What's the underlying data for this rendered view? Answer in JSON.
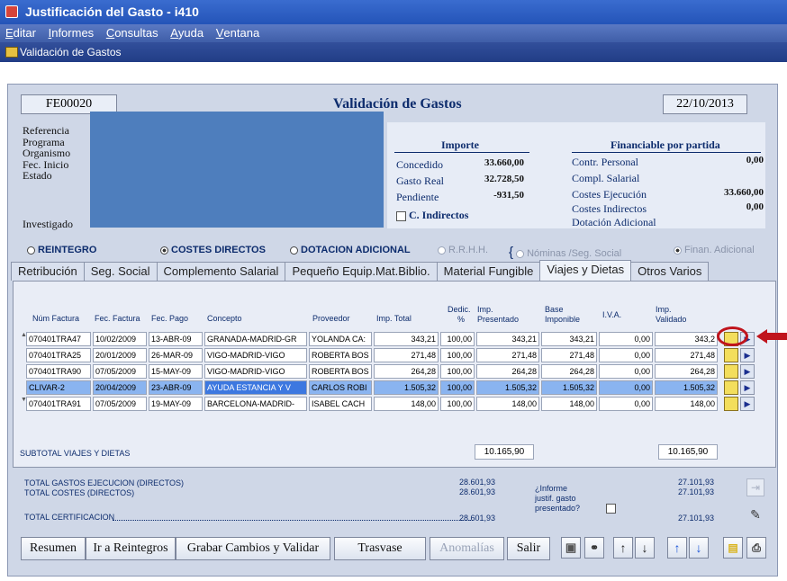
{
  "window": {
    "title": "Justificación del Gasto - i410"
  },
  "menu": [
    {
      "pre": "E",
      "rest": "ditar"
    },
    {
      "pre": "I",
      "rest": "nformes"
    },
    {
      "pre": "C",
      "rest": "onsultas"
    },
    {
      "pre": "A",
      "rest": "yuda"
    },
    {
      "pre": "V",
      "rest": "entana"
    }
  ],
  "subwindow": {
    "title": "Validación de Gastos"
  },
  "header": {
    "doc_number": "FE00020",
    "title": "Validación de Gastos",
    "date": "22/10/2013"
  },
  "info": {
    "labels": [
      "Referencia",
      "Programa",
      "Organismo",
      "Fec. Inicio",
      "Estado"
    ],
    "investigador": "Investigado"
  },
  "importe": {
    "heading": "Importe",
    "rows": [
      {
        "label": "Concedido",
        "value": "33.660,00"
      },
      {
        "label": "Gasto Real",
        "value": "32.728,50"
      },
      {
        "label": "Pendiente",
        "value": "-931,50"
      }
    ],
    "c_indirectos": "C. Indirectos"
  },
  "financiable": {
    "heading": "Financiable por partida",
    "rows": [
      {
        "label": "Contr. Personal",
        "value": "0,00"
      },
      {
        "label": "Compl. Salarial",
        "value": ""
      },
      {
        "label": "Costes Ejecución",
        "value": "33.660,00"
      },
      {
        "label": "Costes Indirectos",
        "value": "0,00"
      },
      {
        "label": "Dotación Adicional",
        "value": ""
      }
    ]
  },
  "options": {
    "reintegro": "REINTEGRO",
    "costes_directos": "COSTES DIRECTOS",
    "dotacion": "DOTACION ADICIONAL",
    "rrhh": "R.R.H.H.",
    "nominas": "Nóminas /Seg. Social",
    "finan": "Finan. Adicional"
  },
  "tabs": [
    "Retribución",
    "Seg. Social",
    "Complemento Salarial",
    "Pequeño Equip.Mat.Biblio.",
    "Material Fungible",
    "Viajes y Dietas",
    "Otros Varios"
  ],
  "active_tab": "Viajes y Dietas",
  "columns": {
    "num_factura": "Núm Factura",
    "fec_factura": "Fec. Factura",
    "fec_pago": "Fec. Pago",
    "concepto": "Concepto",
    "proveedor": "Proveedor",
    "imp_total": "Imp. Total",
    "dedic_1": "Dedic.",
    "dedic_2": "%",
    "imp_pres_1": "Imp.",
    "imp_pres_2": "Presentado",
    "base_1": "Base",
    "base_2": "Imponible",
    "iva": "I.V.A.",
    "imp_val_1": "Imp.",
    "imp_val_2": "Validado"
  },
  "rows": [
    {
      "factura": "070401TRA47",
      "fec_factura": "10/02/2009",
      "fec_pago": "13-ABR-09",
      "concepto": "GRANADA-MADRID-GR",
      "proveedor": "YOLANDA CA:",
      "imp_total": "343,21",
      "dedic": "100,00",
      "presentado": "343,21",
      "base": "343,21",
      "iva": "0,00",
      "validado": "343,2"
    },
    {
      "factura": "070401TRA25",
      "fec_factura": "20/01/2009",
      "fec_pago": "26-MAR-09",
      "concepto": "VIGO-MADRID-VIGO",
      "proveedor": "ROBERTA BOS",
      "imp_total": "271,48",
      "dedic": "100,00",
      "presentado": "271,48",
      "base": "271,48",
      "iva": "0,00",
      "validado": "271,48"
    },
    {
      "factura": "070401TRA90",
      "fec_factura": "07/05/2009",
      "fec_pago": "15-MAY-09",
      "concepto": "VIGO-MADRID-VIGO",
      "proveedor": "ROBERTA BOS",
      "imp_total": "264,28",
      "dedic": "100,00",
      "presentado": "264,28",
      "base": "264,28",
      "iva": "0,00",
      "validado": "264,28"
    },
    {
      "factura": "CLIVAR-2",
      "fec_factura": "20/04/2009",
      "fec_pago": "23-ABR-09",
      "concepto": "AYUDA ESTANCIA Y V",
      "proveedor": "CARLOS ROBI",
      "imp_total": "1.505,32",
      "dedic": "100,00",
      "presentado": "1.505,32",
      "base": "1.505,32",
      "iva": "0,00",
      "validado": "1.505,32"
    },
    {
      "factura": "070401TRA91",
      "fec_factura": "07/05/2009",
      "fec_pago": "19-MAY-09",
      "concepto": "BARCELONA-MADRID-",
      "proveedor": "ISABEL CACH",
      "imp_total": "148,00",
      "dedic": "100,00",
      "presentado": "148,00",
      "base": "148,00",
      "iva": "0,00",
      "validado": "148,00"
    }
  ],
  "subtotal": {
    "label": "SUBTOTAL VIAJES Y DIETAS",
    "presentado": "10.165,90",
    "validado": "10.165,90"
  },
  "totals": {
    "gastos_label": "TOTAL GASTOS EJECUCION (DIRECTOS)",
    "costes_label": "TOTAL COSTES (DIRECTOS)",
    "cert_label": "TOTAL CERTIFICACION",
    "gastos_pres": "28.601,93",
    "costes_pres": "28.601,93",
    "cert_pres": "28.601,93",
    "gastos_val": "27.101,93",
    "costes_val": "27.101,93",
    "cert_val": "27.101,93",
    "informe_1": "¿Informe",
    "informe_2": "justif. gasto",
    "informe_3": "presentado?"
  },
  "buttons": {
    "resumen": "Resumen",
    "reintegros": "Ir a Reintegros",
    "grabar": "Grabar Cambios y Validar",
    "trasvase": "Trasvase",
    "anomalias": "Anomalías",
    "salir": "Salir"
  },
  "icons": {
    "row_folder": "folder-icon",
    "row_next": "play-icon",
    "toolbar": [
      "open-folder-icon",
      "binoculars-icon",
      "arrow-up-icon",
      "arrow-down-icon",
      "arrow-up-blue-icon",
      "arrow-down-blue-icon",
      "document-icon",
      "printer-icon"
    ]
  },
  "colors": {
    "title_bar": "#2454b8",
    "form_bg": "#cfd7e7",
    "highlight": "#3d78e0",
    "marker": "#c0141c"
  }
}
